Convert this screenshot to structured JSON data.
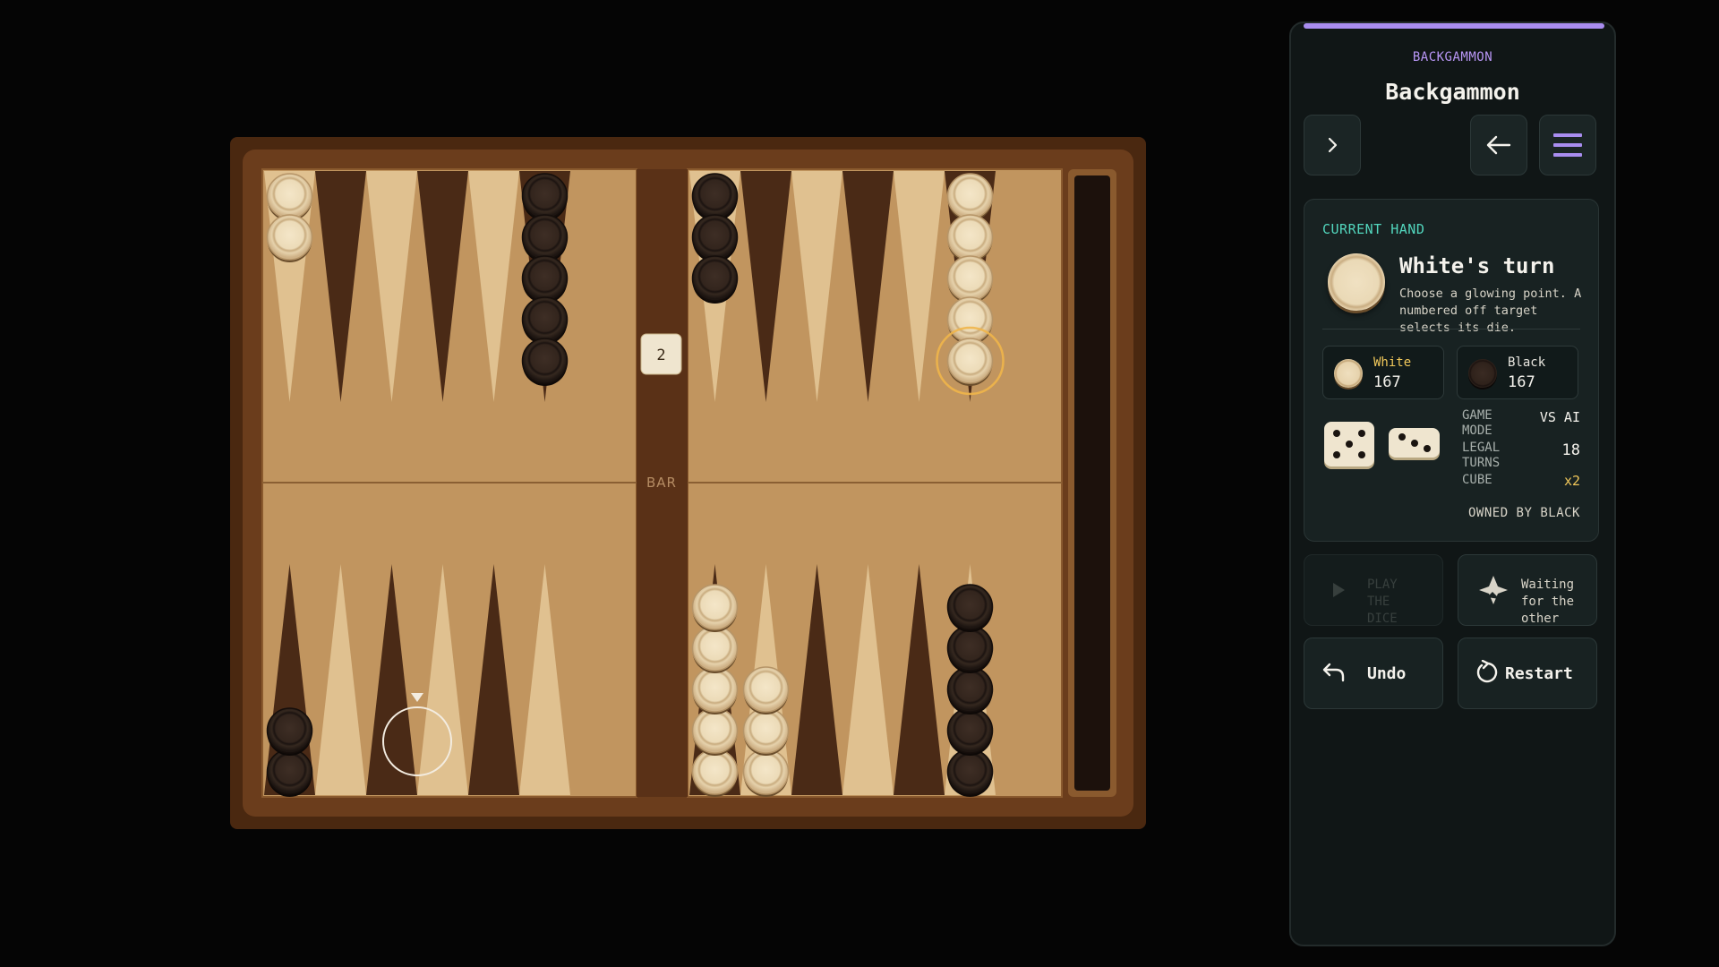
{
  "panel": {
    "eyebrow": "BACKGAMMON",
    "title": "Backgammon",
    "accent_color": "#a98df0"
  },
  "toolbar": {
    "next_icon": "chevron-right-icon",
    "back_icon": "arrow-left-icon",
    "menu_icon": "hamburger-menu-icon"
  },
  "hand": {
    "eyebrow": "CURRENT HAND",
    "turn_title": "White's turn",
    "turn_description": "Choose a glowing point. A numbered off target selects its die.",
    "players": [
      {
        "name": "White",
        "pips": "167",
        "color": "#ead9b6"
      },
      {
        "name": "Black",
        "pips": "167",
        "color": "#2f221b"
      }
    ],
    "dice": [
      5,
      3
    ],
    "stats": {
      "mode_label": "GAME MODE",
      "mode_value": "VS AI",
      "turns_label": "LEGAL TURNS",
      "turns_value": "18",
      "cube_label": "CUBE",
      "cube_value": "x2",
      "owner": "OWNED BY BLACK"
    }
  },
  "actions": {
    "play_label": "PLAY THE DICE",
    "double_label": "Waiting for the other",
    "undo_label": "Undo",
    "restart_label": "Restart"
  },
  "board": {
    "bar_label": "BAR",
    "cube_value": "2",
    "colors": {
      "frame": "#6b3d1c",
      "felt": "#c1955f",
      "dark_point": "#4a2a16",
      "light_point": "#e0c190",
      "white_checker": "#ead9b6",
      "black_checker": "#2f221b",
      "highlight": "#f0b54a"
    },
    "points": [
      {
        "point": 24,
        "owner": "white",
        "count": 5,
        "selected": true
      },
      {
        "point": 19,
        "owner": "black",
        "count": 3
      },
      {
        "point": 18,
        "owner": "black",
        "count": 5
      },
      {
        "point": 13,
        "owner": "white",
        "count": 2
      },
      {
        "point": 1,
        "owner": "black",
        "count": 5
      },
      {
        "point": 3,
        "owner": "none",
        "count": 0,
        "target": true
      },
      {
        "point": 5,
        "owner": "white",
        "count": 3
      },
      {
        "point": 6,
        "owner": "white",
        "count": 5
      },
      {
        "point": 12,
        "owner": "black",
        "count": 2
      }
    ]
  }
}
